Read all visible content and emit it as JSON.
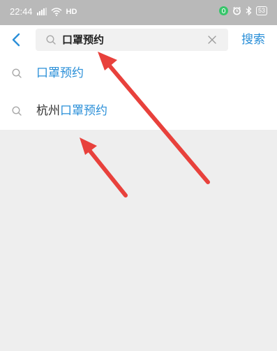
{
  "status_bar": {
    "time": "22:44",
    "network": "HD",
    "battery": "53",
    "icons": [
      "signal-icon",
      "wifi-icon",
      "vpn-icon",
      "alarm-icon",
      "bluetooth-icon",
      "battery-icon"
    ]
  },
  "header": {
    "back_icon": "chevron-left-icon",
    "search_value": "口罩预约",
    "clear_icon": "close-icon",
    "search_label": "搜索"
  },
  "suggestions": [
    {
      "prefix": "",
      "match": "口罩预约"
    },
    {
      "prefix": "杭州",
      "match": "口罩预约"
    }
  ],
  "annotations": {
    "arrow_color": "#e8413c",
    "arrow_count": 2
  },
  "colors": {
    "accent": "#2a8fd8",
    "status_bar": "#b9b9b9",
    "background": "#eeeeee"
  }
}
